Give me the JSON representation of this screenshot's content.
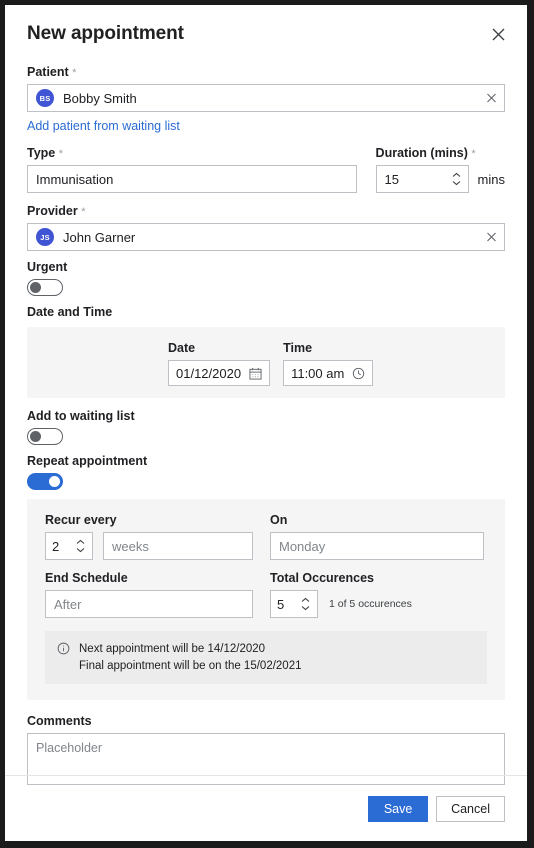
{
  "dialog": {
    "title": "New appointment",
    "close_icon": "close-icon"
  },
  "patient": {
    "label": "Patient",
    "required_mark": "*",
    "avatar_initials": "BS",
    "value": "Bobby Smith",
    "clear_icon": "close-icon",
    "waiting_list_link": "Add patient from waiting list"
  },
  "type": {
    "label": "Type",
    "required_mark": "*",
    "value": "Immunisation"
  },
  "duration": {
    "label": "Duration (mins)",
    "required_mark": "*",
    "value": "15",
    "unit": "mins"
  },
  "provider": {
    "label": "Provider",
    "required_mark": "*",
    "avatar_initials": "JS",
    "value": "John Garner",
    "clear_icon": "close-icon"
  },
  "urgent": {
    "label": "Urgent",
    "state": "off"
  },
  "date_time": {
    "section_label": "Date and Time",
    "date_label": "Date",
    "date_value": "01/12/2020",
    "date_icon": "calendar-icon",
    "time_label": "Time",
    "time_value": "11:00 am",
    "time_icon": "clock-icon"
  },
  "waiting_list": {
    "label": "Add to waiting list",
    "state": "off"
  },
  "repeat": {
    "label": "Repeat appointment",
    "state": "on",
    "recur_every_label": "Recur every",
    "recur_every_value": "2",
    "recur_unit_placeholder": "weeks",
    "on_label": "On",
    "on_placeholder": "Monday",
    "end_schedule_label": "End Schedule",
    "end_schedule_placeholder": "After",
    "total_occurrences_label": "Total Occurences",
    "total_occurrences_value": "5",
    "occurrence_note": "1 of 5 occurences",
    "notice_icon": "info-icon",
    "notice_line_1": "Next appointment will be 14/12/2020",
    "notice_line_2": "Final appointment will be on the 15/02/2021"
  },
  "comments": {
    "label": "Comments",
    "placeholder": "Placeholder"
  },
  "footer": {
    "save_label": "Save",
    "cancel_label": "Cancel"
  },
  "colors": {
    "accent_blue": "#2b6bd4",
    "avatar_blue": "#4055d4",
    "link_blue": "#2b6bd4",
    "panel_gray": "#f5f5f5",
    "notice_gray": "#ececec",
    "border_gray": "#bdc1c6"
  }
}
